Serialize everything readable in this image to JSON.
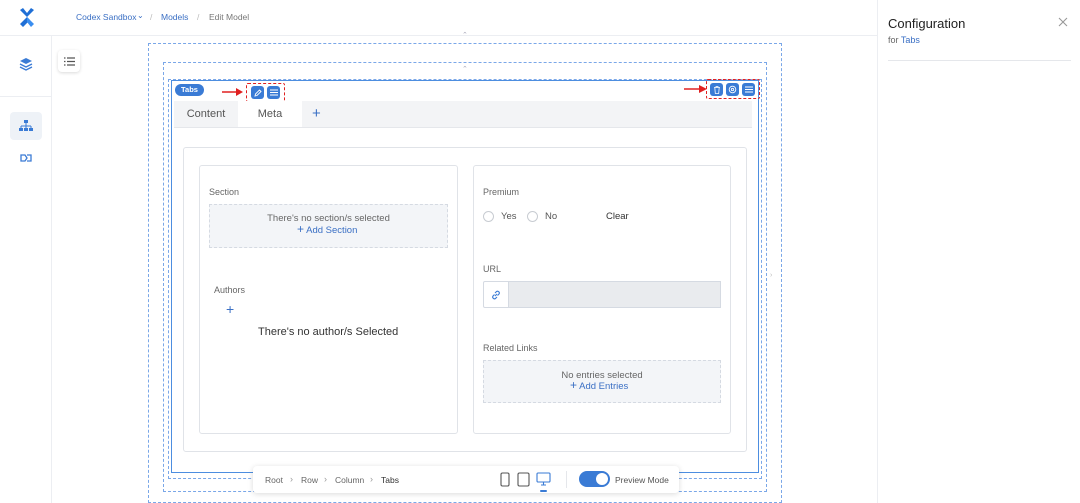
{
  "breadcrumb": {
    "project": "Codex Sandbox",
    "models": "Models",
    "current": "Edit Model"
  },
  "config_panel": {
    "title": "Configuration",
    "for_prefix": "for",
    "for_target": "Tabs"
  },
  "canvas": {
    "tabs_badge": "Tabs",
    "tabs": [
      "Content",
      "Meta"
    ],
    "left_card": {
      "section_label": "Section",
      "section_empty": "There's no section/s selected",
      "add_section": "Add Section",
      "authors_label": "Authors",
      "authors_empty": "There's no author/s Selected"
    },
    "right_card": {
      "premium_label": "Premium",
      "yes": "Yes",
      "no": "No",
      "clear": "Clear",
      "url_label": "URL",
      "related_label": "Related Links",
      "related_empty": "No entries selected",
      "add_entries": "Add Entries"
    }
  },
  "bottom_toolbar": {
    "path": [
      "Root",
      "Row",
      "Column",
      "Tabs"
    ],
    "preview_label": "Preview Mode",
    "preview_on": true
  },
  "colors": {
    "accent": "#3a7bd5",
    "annotation": "#e02020"
  }
}
